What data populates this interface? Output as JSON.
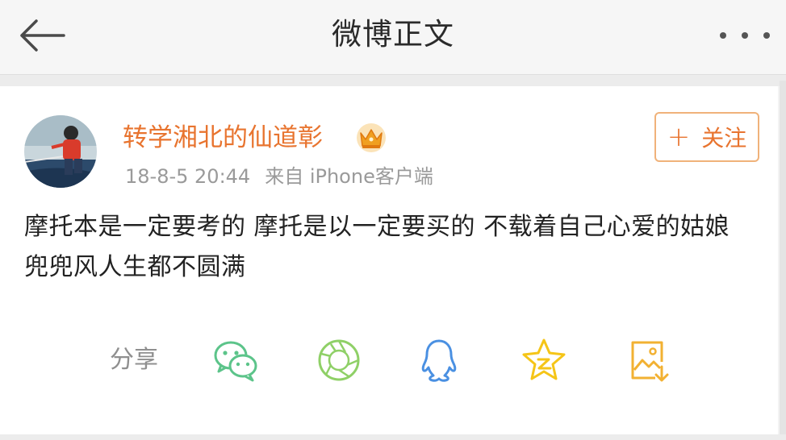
{
  "header": {
    "title": "微博正文",
    "back_icon": "back-arrow-icon",
    "more_icon": "more-dots-icon"
  },
  "post": {
    "user_name": "转学湘北的仙道彰",
    "badge_icon": "crown-icon",
    "time": "18-8-5 20:44",
    "source": "来自 iPhone客户端",
    "follow_label": "关注",
    "follow_icon": "plus-icon",
    "text": "摩托本是一定要考的 摩托是以一定要买的 不载着自己心爱的姑娘兜兜风人生都不圆满"
  },
  "share": {
    "label": "分享",
    "targets": [
      {
        "icon": "wechat-icon"
      },
      {
        "icon": "moments-icon"
      },
      {
        "icon": "qq-icon"
      },
      {
        "icon": "qzone-icon"
      },
      {
        "icon": "save-image-icon"
      }
    ]
  },
  "colors": {
    "accent": "#e8742f",
    "follow_border": "#f0b27a",
    "wechat": "#5cc48a",
    "moments": "#8fd067",
    "qq": "#4a90e2",
    "qzone": "#f5c518",
    "save_image": "#f2b132"
  }
}
